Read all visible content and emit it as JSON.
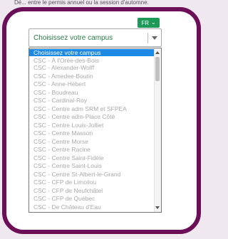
{
  "page": {
    "top_text": "Dé... entre le permis annuel ou la session d'automne."
  },
  "language": {
    "label": "FR",
    "icon": "chevron-down-icon"
  },
  "campus_select": {
    "value": "Choisissez votre campus",
    "options": [
      "Choisissez votre campus",
      "CSC - À l'Orée-des-Bois",
      "CSC - Alexander-Wolff",
      "CSC - Amedee-Boutin",
      "CSC - Anne-Hébert",
      "CSC - Boudreau",
      "CSC - Cardinal-Roy",
      "CSC - Centre adm SRM et SFPEA",
      "CSC - Centre adm-Place Côté",
      "CSC - Centre Louis-Jolliet",
      "CSC - Centre Masson",
      "CSC - Centre Morse",
      "CSC - Centre Racine",
      "CSC - Centre Saint-Fidèle",
      "CSC - Centre Saint-Louis",
      "CSC - Centre St-Albert-le-Grand",
      "CSC - CFP de Limoilou",
      "CSC - CFP de Neufchâtel",
      "CSC - CFP de Québec",
      "CSC - De Château d'Eau"
    ],
    "selected_index": 0
  },
  "colors": {
    "frame": "#6c0e58",
    "accent_green": "#1d9a57",
    "selected_blue": "#1e88e5",
    "option_text": "#aaaaaa"
  }
}
